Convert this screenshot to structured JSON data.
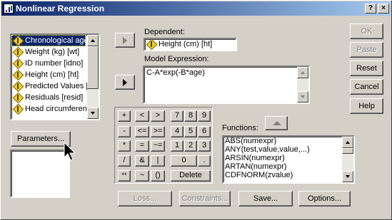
{
  "window": {
    "title": "Nonlinear Regression",
    "help_glyph": "?",
    "close_glyph": "×"
  },
  "variables": [
    {
      "label": "Chronological age",
      "icon": "scale-variable-icon",
      "selected": true
    },
    {
      "label": "Weight (kg) [wt]",
      "icon": "scale-variable-icon"
    },
    {
      "label": "ID number [idno]",
      "icon": "scale-variable-icon"
    },
    {
      "label": "Height (cm) [ht]",
      "icon": "scale-variable-icon"
    },
    {
      "label": "Predicted Values [",
      "icon": "scale-variable-icon"
    },
    {
      "label": "Residuals [resid]",
      "icon": "scale-variable-icon"
    },
    {
      "label": "Head circumferen",
      "icon": "scale-variable-icon"
    }
  ],
  "parameters_button": "Parameters...",
  "dependent": {
    "label": "Dependent:",
    "value": "Height (cm) [ht]"
  },
  "model": {
    "label": "Model Expression:",
    "value": "C-A*exp(-B*age)"
  },
  "keypad": {
    "row1": [
      "+",
      "<",
      ">",
      "7",
      "8",
      "9"
    ],
    "row2": [
      "-",
      "<=",
      ">=",
      "4",
      "5",
      "6"
    ],
    "row3": [
      "*",
      "=",
      "~=",
      "1",
      "2",
      "3"
    ],
    "row4": [
      "/",
      "&",
      "|",
      "0",
      "."
    ],
    "row5": [
      "**",
      "~",
      "()",
      "Delete"
    ]
  },
  "functions": {
    "label": "Functions:",
    "items": [
      "ABS(numexpr)",
      "ANY(test,value,value,...)",
      "ARSIN(numexpr)",
      "ARTAN(numexpr)",
      "CDFNORM(zvalue)"
    ]
  },
  "side_buttons": {
    "ok": "OK",
    "paste": "Paste",
    "reset": "Reset",
    "cancel": "Cancel",
    "help": "Help"
  },
  "bottom_buttons": {
    "loss": "Loss...",
    "constraints": "Constraints...",
    "save": "Save...",
    "options": "Options..."
  },
  "colors": {
    "selection": "#0a246a",
    "face": "#d4d0c8",
    "disabled_text": "#808080"
  }
}
